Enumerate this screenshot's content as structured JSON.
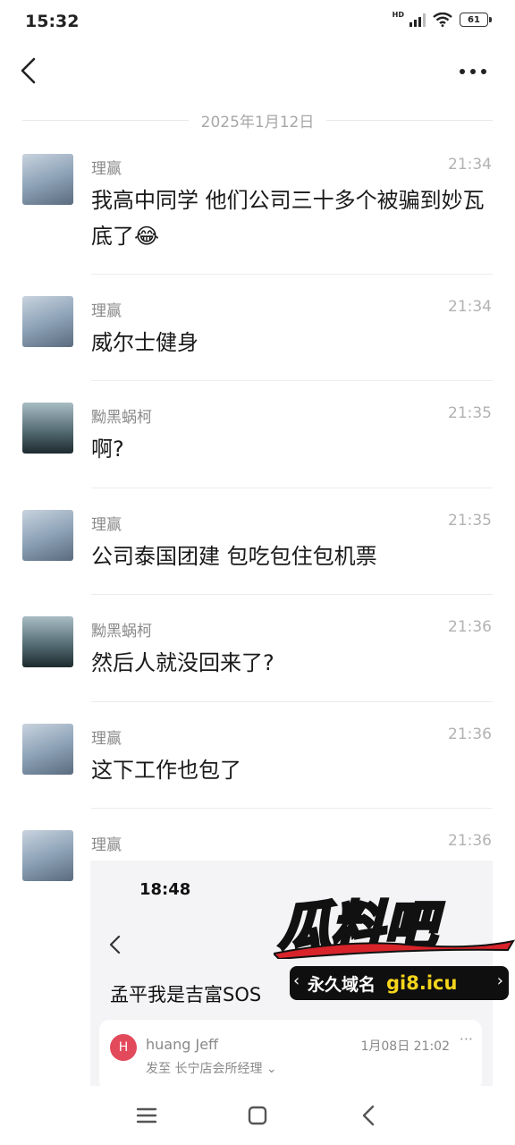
{
  "status_bar": {
    "time": "15:32",
    "network": "HD",
    "battery": "61"
  },
  "date_divider": "2025年1月12日",
  "messages": [
    {
      "name": "理赢",
      "time": "21:34",
      "text": "我高中同学 他们公司三十多个被骗到妙瓦底了",
      "emoji": "😂"
    },
    {
      "name": "理赢",
      "time": "21:34",
      "text": "威尔士健身"
    },
    {
      "name": "黝黑蜗柯",
      "time": "21:35",
      "text": "啊?"
    },
    {
      "name": "理赢",
      "time": "21:35",
      "text": "公司泰国团建 包吃包住包机票"
    },
    {
      "name": "黝黑蜗柯",
      "time": "21:36",
      "text": "然后人就没回来了?"
    },
    {
      "name": "理赢",
      "time": "21:36",
      "text": "这下工作也包了"
    },
    {
      "name": "理赢",
      "time": "21:36"
    }
  ],
  "embedded_screenshot": {
    "time": "18:48",
    "title": "孟平我是吉富SOS",
    "avatar_letter": "H",
    "sender": "huang Jeff",
    "date": "1月08日 21:02",
    "to": "发至 长宁店会所经理 ⌄"
  },
  "watermark": {
    "brand": "瓜料吧",
    "label": "永久域名",
    "domain": "gi8.icu"
  }
}
